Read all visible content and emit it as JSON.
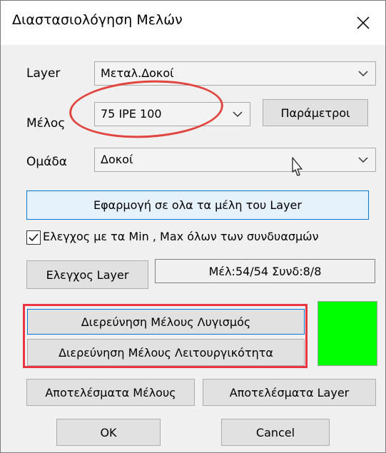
{
  "window": {
    "title": "Διαστασιολόγηση Μελών",
    "close_icon": "close-icon"
  },
  "form": {
    "layer": {
      "label": "Layer",
      "value": "Μεταλ.Δοκοί"
    },
    "member": {
      "label": "Μέλος",
      "value": "75 IPE 100"
    },
    "group": {
      "label": "Ομάδα",
      "value": "Δοκοί"
    }
  },
  "buttons": {
    "parameters": "Παράμετροι",
    "apply_all": "Εφαρμογή σε ολα τα μέλη του Layer",
    "check_layer": "Ελεγχος Layer",
    "investigate_buckling": "Διερεύνηση Μέλους Λυγισμός",
    "investigate_serviceability": "Διερεύνηση Μέλους Λειτουργικότητα",
    "member_results": "Αποτελέσματα Μέλους",
    "layer_results": "Αποτελέσματα Layer",
    "ok": "OK",
    "cancel": "Cancel"
  },
  "check_minmax": {
    "label": "Ελεγχος με τα Min , Max όλων των συνδυασμών",
    "checked": true
  },
  "status": {
    "summary": "Μέλ:54/54 Συνδ:8/8",
    "swatch_color": "#00ff00"
  },
  "annotations": {
    "ellipse_color": "#e0463f",
    "rect_color": "#e8353f"
  }
}
